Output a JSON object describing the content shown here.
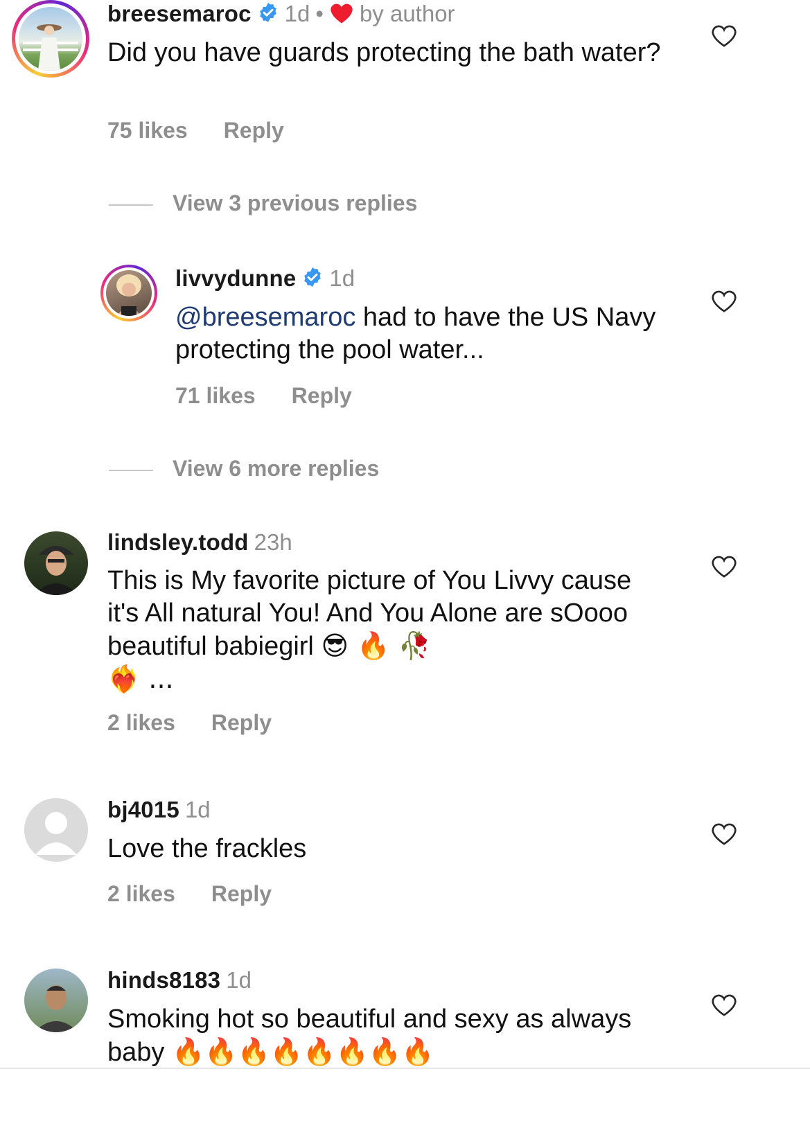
{
  "comments": [
    {
      "username": "breesemaroc",
      "time": "1d",
      "dot": "•",
      "by_author": "by author",
      "text": "Did you have guards protecting the bath water?",
      "likes": "75 likes",
      "reply": "Reply"
    },
    {
      "username": "livvydunne",
      "time": "1d",
      "mention": "@breesemaroc",
      "text": " had to have the US Navy protecting the pool water...",
      "likes": "71 likes",
      "reply": "Reply"
    },
    {
      "username": "lindsley.todd",
      "time": "23h",
      "text": "This is My favorite picture of You Livvy cause it's All natural You! And You Alone are sOooo beautiful babiegirl",
      "emoji_tail": "😎 🔥 🥀",
      "emoji_line2": "❤️‍🔥 ...",
      "likes": "2 likes",
      "reply": "Reply"
    },
    {
      "username": "bj4015",
      "time": "1d",
      "text": "Love the frackles",
      "likes": "2 likes",
      "reply": "Reply"
    },
    {
      "username": "hinds8183",
      "time": "1d",
      "text": "Smoking hot so beautiful and sexy as always baby",
      "emoji_tail": "🔥🔥🔥🔥🔥🔥🔥🔥"
    }
  ],
  "view_previous": "View 3 previous replies",
  "view_more": "View 6 more replies",
  "colors": {
    "accent_verified": "#3897f0",
    "like_heart": "#ed4956",
    "muted": "#8e8e8e",
    "mention": "#1f3b73"
  },
  "icons": [
    "heart-outline-icon",
    "verified-badge-icon",
    "heart-filled-icon",
    "default-avatar-icon"
  ]
}
